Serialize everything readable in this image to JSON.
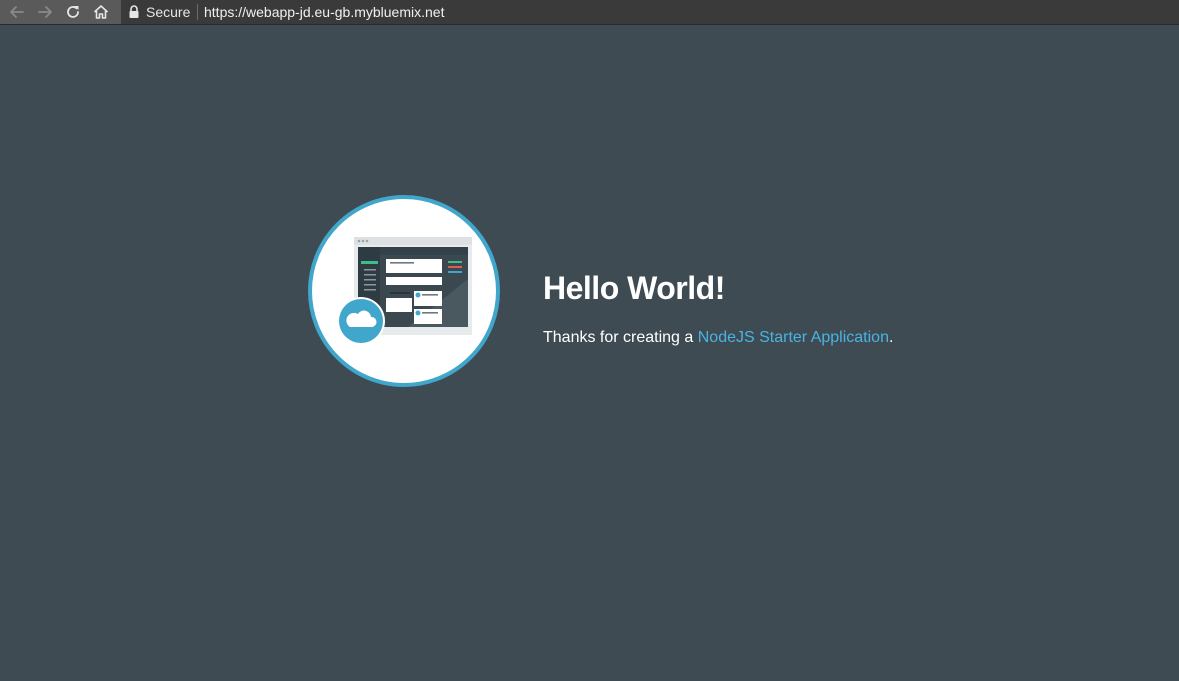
{
  "browser": {
    "secure_label": "Secure",
    "url": "https://webapp-jd.eu-gb.mybluemix.net",
    "icons": [
      "back-arrow-icon",
      "forward-arrow-icon",
      "reload-icon",
      "home-icon",
      "lock-icon"
    ]
  },
  "page": {
    "heading": "Hello World!",
    "intro_prefix": "Thanks for creating a ",
    "link_text": "NodeJS Starter Application",
    "intro_suffix": "."
  },
  "colors": {
    "background": "#3e4b52",
    "accent": "#41a6cc",
    "link": "#4bb3e3",
    "text": "#ffffff"
  }
}
